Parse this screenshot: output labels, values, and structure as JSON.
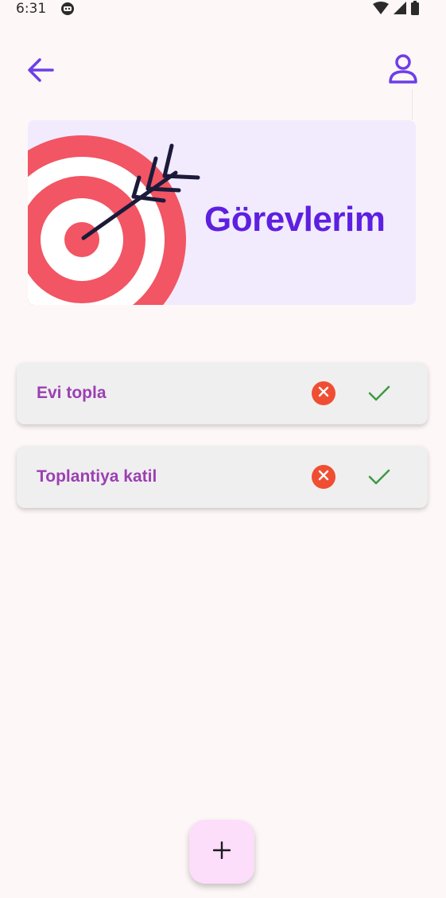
{
  "status_bar": {
    "time": "6:31",
    "icons": [
      "app-icon",
      "wifi-icon",
      "signal-icon",
      "battery-icon"
    ]
  },
  "toolbar": {
    "back_icon": "arrow-left-icon",
    "profile_icon": "person-icon"
  },
  "hero": {
    "title": "Görevlerim",
    "image": "target-arrow-illustration"
  },
  "tasks": [
    {
      "label": "Evi topla"
    },
    {
      "label": "Toplantiya katil"
    }
  ],
  "fab": {
    "label": "+"
  },
  "colors": {
    "background": "#fdf7f7",
    "accent": "#6d3ee8",
    "title": "#5e1fe0",
    "task_text": "#9c3fb3",
    "delete": "#f04e33",
    "complete": "#3f9a48",
    "fab": "#fcddfa",
    "hero_bg": "#f1ebfd",
    "target_red": "#f25563"
  }
}
